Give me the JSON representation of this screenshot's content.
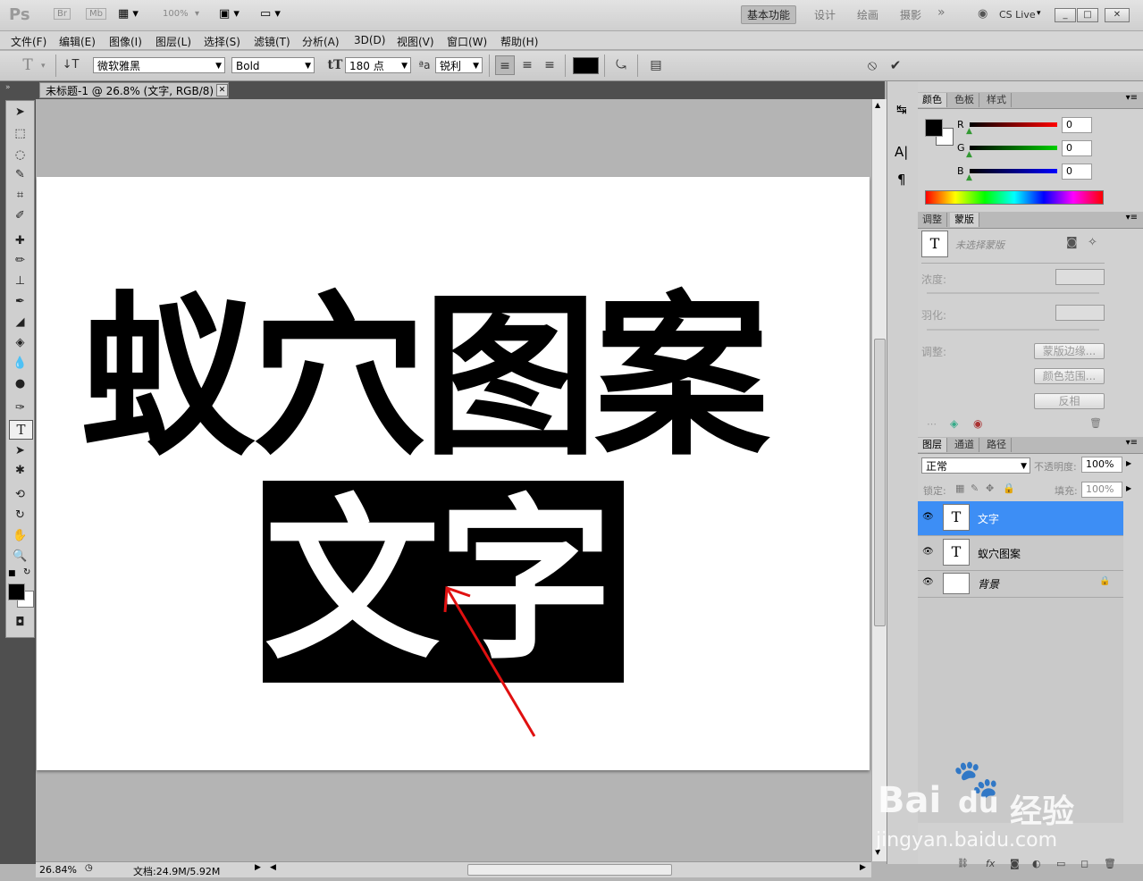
{
  "app": {
    "logo": "Ps",
    "bridge_label": "Br",
    "minibridge_label": "Mb",
    "zoom_combo": "100%",
    "workspaces": [
      "基本功能",
      "设计",
      "绘画",
      "摄影"
    ],
    "more": "»",
    "cs_live": "CS Live",
    "window_controls": [
      "_",
      "□",
      "✕"
    ]
  },
  "menu": [
    "文件(F)",
    "编辑(E)",
    "图像(I)",
    "图层(L)",
    "选择(S)",
    "滤镜(T)",
    "分析(A)",
    "3D(D)",
    "视图(V)",
    "窗口(W)",
    "帮助(H)"
  ],
  "options": {
    "font_family": "微软雅黑",
    "font_style": "Bold",
    "font_size": "180 点",
    "aa_label": "ªa",
    "antialias": "锐利",
    "text_color": "#000000",
    "cancel_icon": "⦸",
    "commit_icon": "✔"
  },
  "document": {
    "tab_title": "未标题-1 @ 26.8% (文字, RGB/8) *",
    "close": "✕",
    "line1": "蚁穴图案",
    "line2": "文字",
    "line2_bg": "#000000"
  },
  "status": {
    "zoom": "26.84%",
    "doc": "文档:24.9M/5.92M"
  },
  "color_panel": {
    "tabs": [
      "颜色",
      "色板",
      "样式"
    ],
    "channels": [
      {
        "name": "R",
        "value": "0",
        "color": "#ff0000"
      },
      {
        "name": "G",
        "value": "0",
        "color": "#00c000"
      },
      {
        "name": "B",
        "value": "0",
        "color": "#0000ff"
      }
    ]
  },
  "masks_panel": {
    "tabs": [
      "调整",
      "蒙版"
    ],
    "status": "未选择蒙版",
    "density_label": "浓度:",
    "feather_label": "羽化:",
    "refine_label": "调整:",
    "buttons": [
      "蒙版边缘...",
      "颜色范围...",
      "反相"
    ]
  },
  "layers_panel": {
    "tabs": [
      "图层",
      "通道",
      "路径"
    ],
    "blend_mode": "正常",
    "opacity_label": "不透明度:",
    "opacity": "100%",
    "lock_label": "锁定:",
    "fill_label": "填充:",
    "fill": "100%",
    "layers": [
      {
        "name": "文字",
        "thumb": "T",
        "selected": true
      },
      {
        "name": "蚁穴图案",
        "thumb": "T",
        "selected": false
      },
      {
        "name": "背景",
        "thumb": "",
        "selected": false
      }
    ]
  },
  "watermark": {
    "brand": "Bai",
    "brand2": "du",
    "cn": "经验",
    "url": "jingyan.baidu.com"
  }
}
